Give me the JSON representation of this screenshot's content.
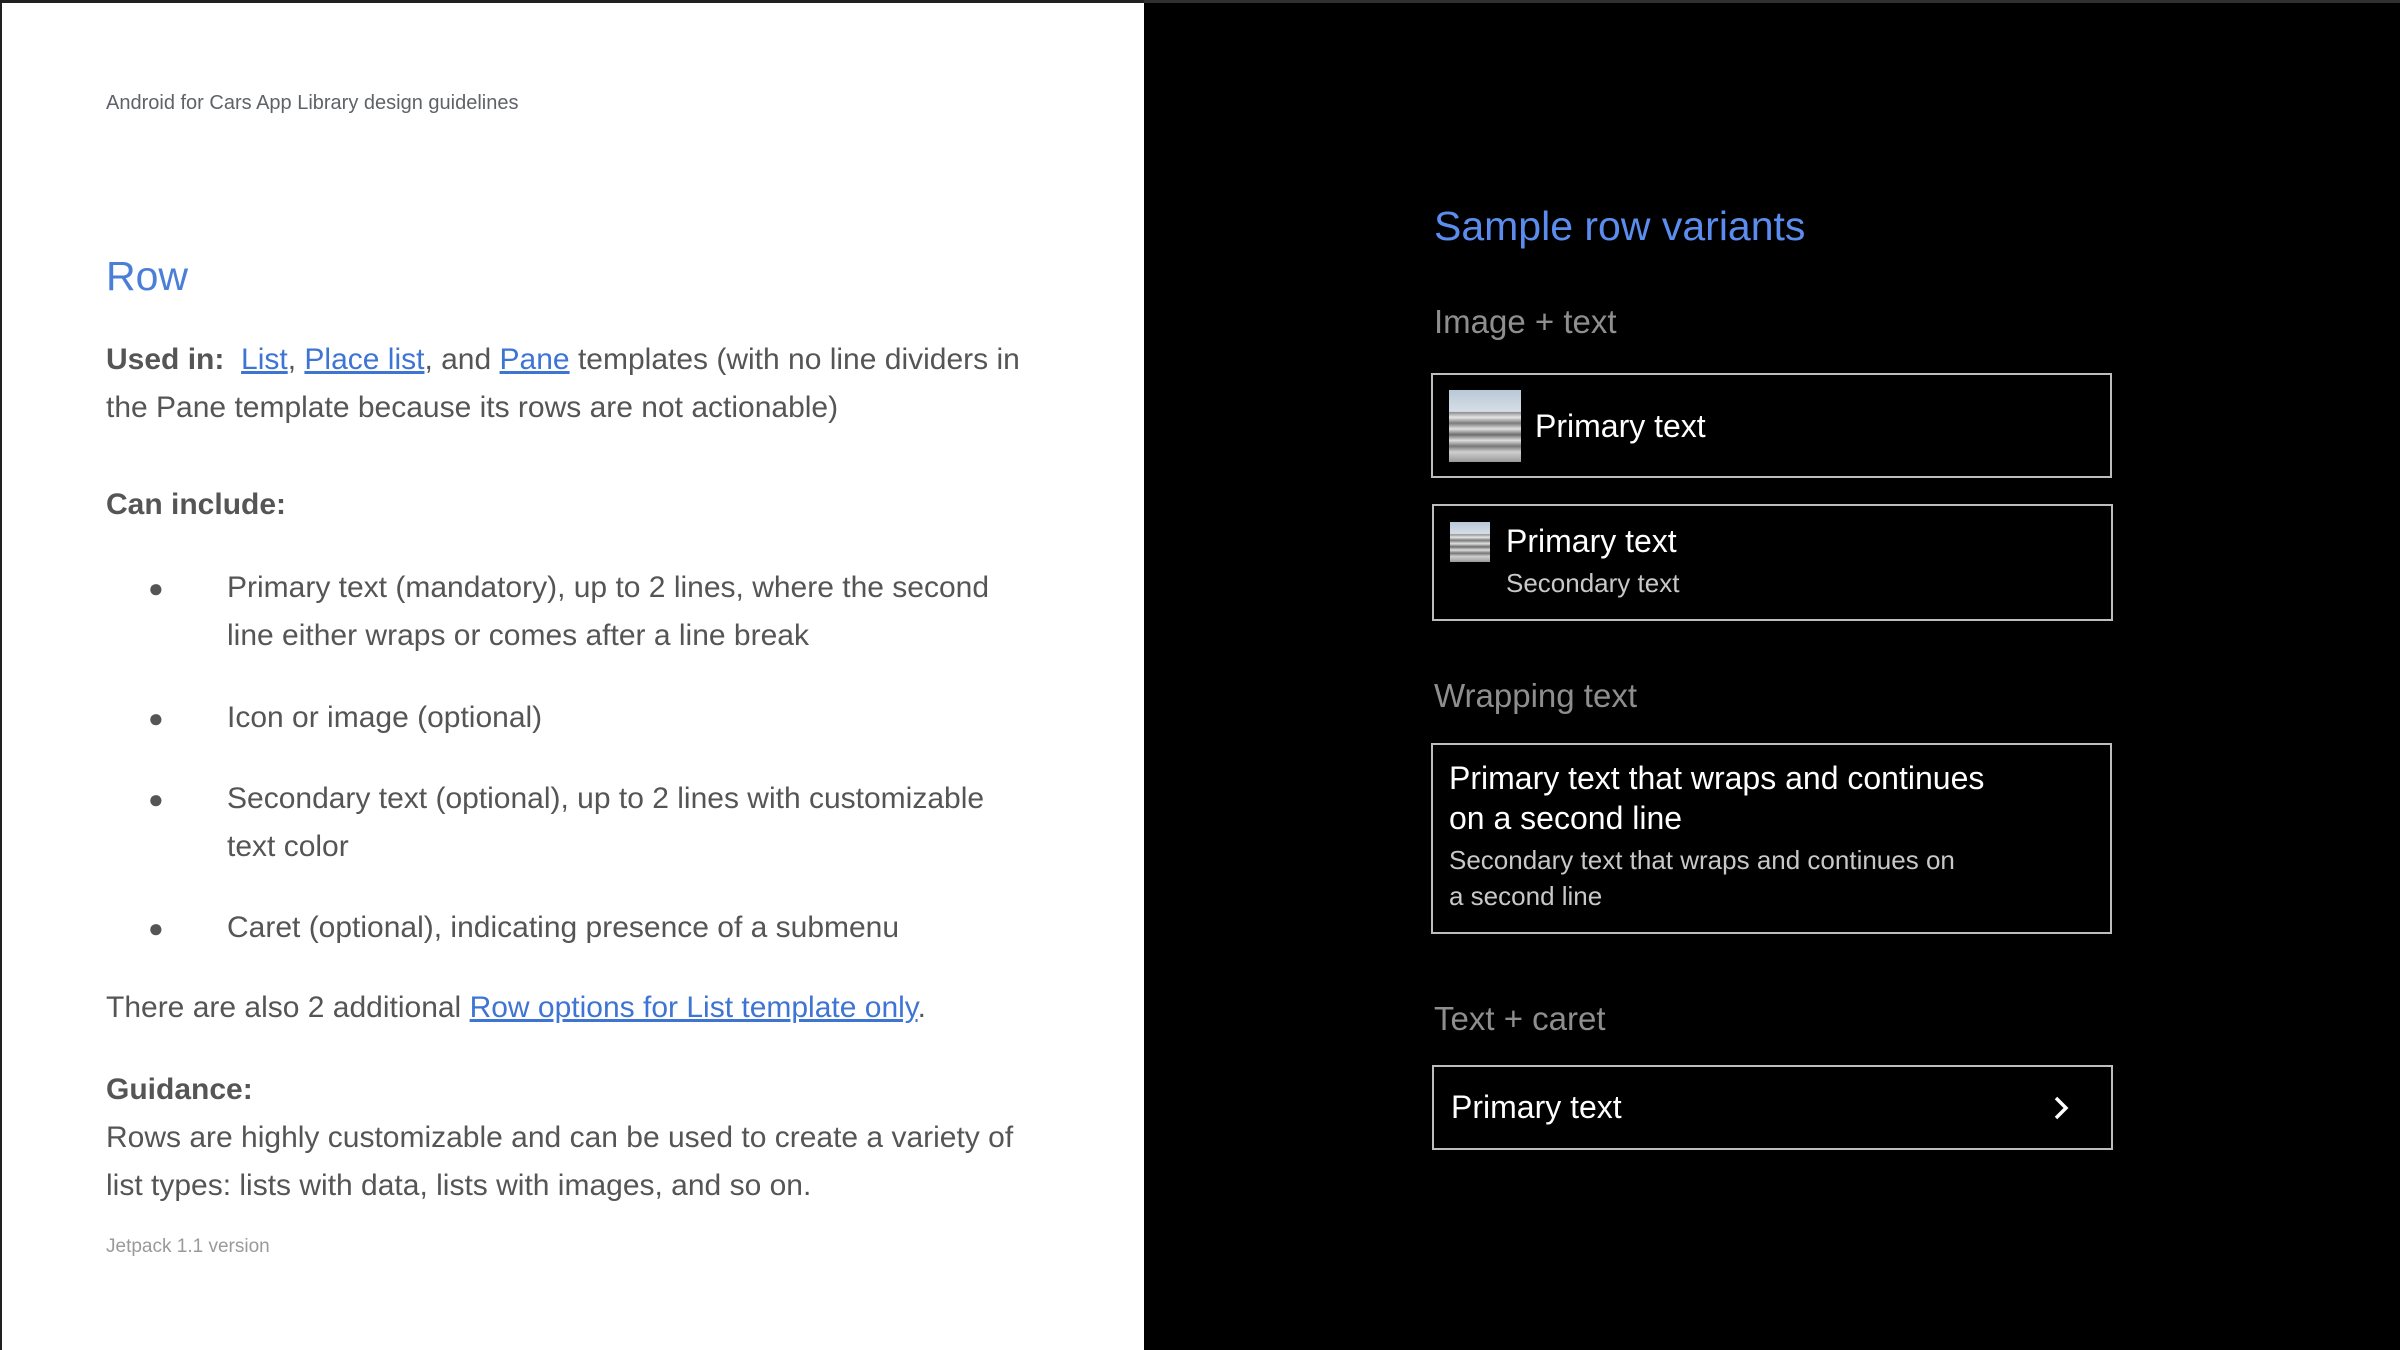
{
  "header": "Android for Cars App Library design guidelines",
  "title": "Row",
  "used_in": {
    "label": "Used in:",
    "link_list": "List",
    "sep1": ",",
    "link_place_list": "Place list",
    "sep2": ", and",
    "link_pane": "Pane",
    "rest": "templates (with no line dividers in the Pane template because its rows are not actionable)"
  },
  "can_include": {
    "label": "Can include:",
    "items": [
      "Primary text (mandatory), up to 2 lines, where the second line either wraps or comes after a line break",
      "Icon or image (optional)",
      "Secondary text (optional), up to 2 lines with customizable text color",
      "Caret (optional), indicating presence of a submenu"
    ]
  },
  "additional": {
    "prefix": "There are also 2 additional",
    "link": "Row options for List template only",
    "suffix": "."
  },
  "guidance": {
    "label": "Guidance:",
    "text": "Rows are highly customizable and can be used to create a variety of list types: lists with data, lists with images, and so on."
  },
  "footer": "Jetpack 1.1 version",
  "samples": {
    "title": "Sample row variants",
    "image_text": {
      "heading": "Image + text",
      "row1_primary": "Primary text",
      "row2_primary": "Primary text",
      "row2_secondary": "Secondary text"
    },
    "wrapping": {
      "heading": "Wrapping text",
      "primary_line1": "Primary text that wraps and continues",
      "primary_line2": "on a second line",
      "secondary_line1": "Secondary text that wraps and continues on",
      "secondary_line2": "a second line"
    },
    "caret": {
      "heading": "Text + caret",
      "primary": "Primary text",
      "icon": "chevron-right-icon"
    }
  }
}
